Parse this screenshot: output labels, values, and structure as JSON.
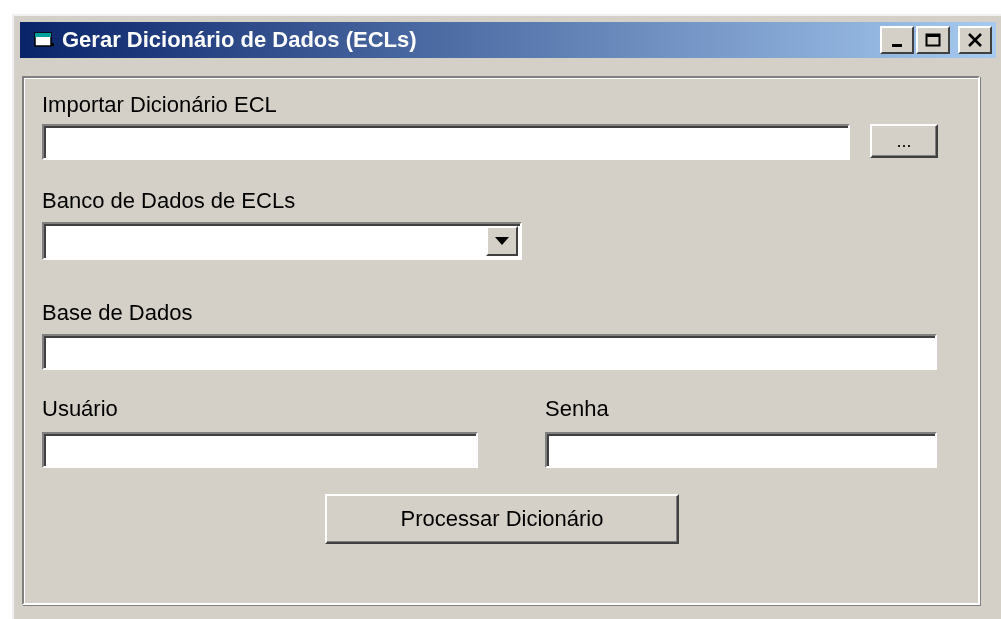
{
  "window": {
    "title": "Gerar Dicionário de Dados (ECLs)"
  },
  "import": {
    "label": "Importar Dicionário ECL",
    "browse_button": "..."
  },
  "database_ecl": {
    "label": "Banco de Dados de ECLs"
  },
  "database": {
    "label": "Base de Dados"
  },
  "user": {
    "label": "Usuário"
  },
  "password": {
    "label": "Senha"
  },
  "process_button": "Processar Dicionário"
}
